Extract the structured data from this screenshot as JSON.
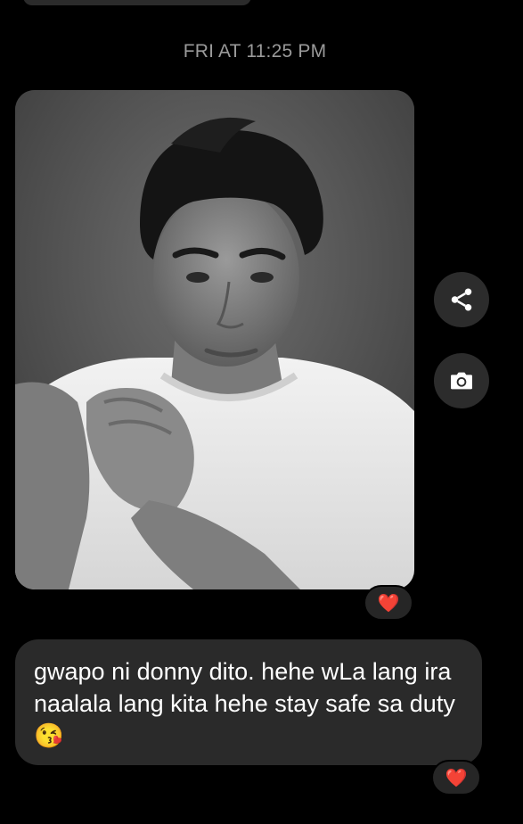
{
  "conversation": {
    "timestamp": "FRI AT 11:25 PM",
    "photo_message": {
      "description_icon": "photo-portrait",
      "reaction": "❤️"
    },
    "side_actions": [
      {
        "icon": "share-icon"
      },
      {
        "icon": "camera-icon"
      }
    ],
    "text_message": {
      "text": "gwapo ni donny dito. hehe wLa lang ira naalala lang kita hehe stay safe sa duty 😘",
      "reaction": "❤️"
    }
  },
  "colors": {
    "background": "#000000",
    "bubble": "#2a2a2a",
    "timestamp": "#9a9a9a",
    "heart": "#e0263c"
  }
}
